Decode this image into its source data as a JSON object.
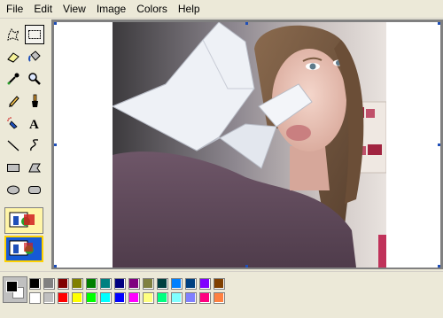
{
  "menu": [
    "File",
    "Edit",
    "View",
    "Image",
    "Colors",
    "Help"
  ],
  "tools": [
    "free-form-select",
    "rectangle-select",
    "eraser",
    "fill-with-color",
    "pick-color",
    "magnifier",
    "pencil",
    "brush",
    "airbrush",
    "text",
    "line",
    "curve",
    "rectangle",
    "polygon",
    "ellipse",
    "rounded-rectangle"
  ],
  "selected_tool": "rectangle-select",
  "colors": {
    "foreground": "#000000",
    "background": "#ffffff",
    "palette_top": [
      "#000000",
      "#808080",
      "#800000",
      "#808000",
      "#008000",
      "#008080",
      "#000080",
      "#800080",
      "#808040",
      "#004040",
      "#0080ff",
      "#004080",
      "#8000ff",
      "#804000"
    ],
    "palette_bottom": [
      "#ffffff",
      "#c0c0c0",
      "#ff0000",
      "#ffff00",
      "#00ff00",
      "#00ffff",
      "#0000ff",
      "#ff00ff",
      "#ffff80",
      "#00ff80",
      "#80ffff",
      "#8080ff",
      "#ff0080",
      "#ff8040"
    ]
  }
}
